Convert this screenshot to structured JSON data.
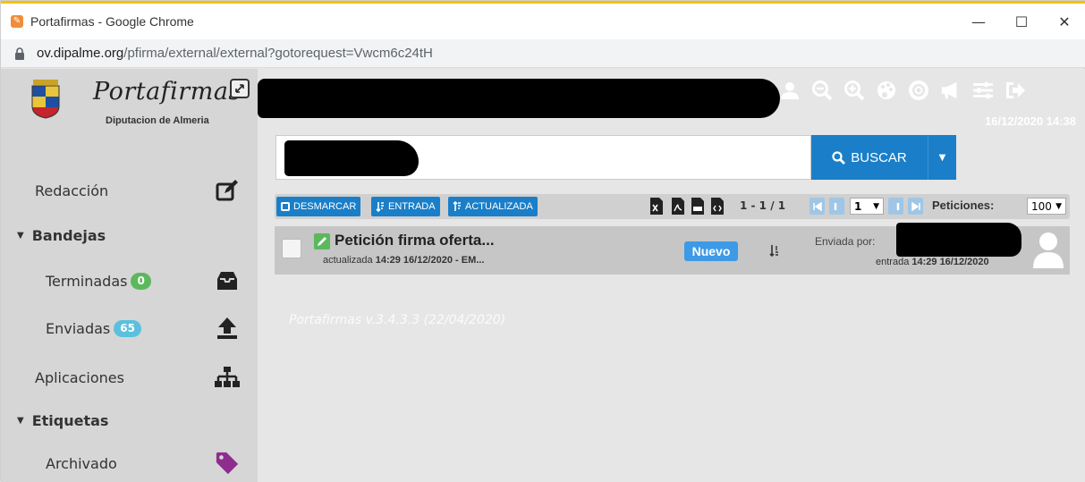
{
  "browser": {
    "window_title": "Portafirmas - Google Chrome",
    "url_host": "ov.dipalme.org",
    "url_path": "/pfirma/external/external?gotorequest=Vwcm6c24tH",
    "controls": {
      "minimize": "—",
      "maximize": "☐",
      "close": "✕"
    }
  },
  "sidebar": {
    "brand_name": "Portafirmas",
    "brand_sub": "Diputacion de Almeria",
    "redaccion": "Redacción",
    "bandejas": "Bandejas",
    "terminadas": "Terminadas",
    "terminadas_count": "0",
    "enviadas": "Enviadas",
    "enviadas_count": "65",
    "aplicaciones": "Aplicaciones",
    "etiquetas": "Etiquetas",
    "archivado": "Archivado"
  },
  "header": {
    "datetime": "16/12/2020 14:38"
  },
  "search": {
    "button_label": "BUSCAR"
  },
  "toolbar": {
    "desmarcar": "DESMARCAR",
    "entrada": "ENTRADA",
    "actualizada": "ACTUALIZADA",
    "count": "1 - 1 / 1",
    "page": "1",
    "peticiones_label": "Peticiones:",
    "peticiones_value": "100"
  },
  "row": {
    "title": "Petición firma oferta...",
    "sub_prefix": "actualizada ",
    "sub_bold": "14:29 16/12/2020 - EM...",
    "status": "Nuevo",
    "enviada_por": "Enviada por:",
    "entrada_prefix": "entrada ",
    "entrada_bold": "14:29 16/12/2020"
  },
  "footer": {
    "version": "Portafirmas v.3.4.3.3 (22/04/2020)"
  },
  "colors": {
    "accent_blue": "#1a7fc8",
    "badge_green": "#5cb85c",
    "badge_blue": "#5bc0de",
    "tag_purple": "#8e2d8e"
  }
}
